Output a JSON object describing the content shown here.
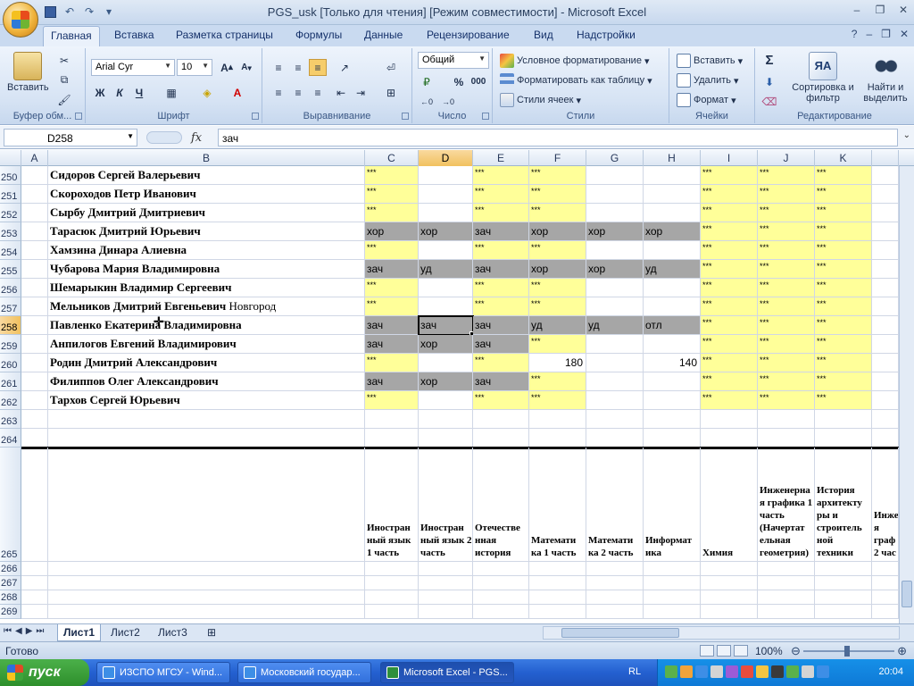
{
  "window": {
    "title": "PGS_usk  [Только для чтения]  [Режим совместимости] - Microsoft Excel"
  },
  "ribbon_tabs": [
    "Главная",
    "Вставка",
    "Разметка страницы",
    "Формулы",
    "Данные",
    "Рецензирование",
    "Вид",
    "Надстройки"
  ],
  "ribbon": {
    "clipboard": {
      "paste": "Вставить",
      "label": "Буфер обм..."
    },
    "font": {
      "name": "Arial Cyr",
      "size": "10",
      "bold": "Ж",
      "italic": "К",
      "underline": "Ч",
      "label": "Шрифт"
    },
    "alignment": {
      "label": "Выравнивание"
    },
    "number": {
      "format": "Общий",
      "percent": "%",
      "thousands": "000",
      "label": "Число"
    },
    "styles": {
      "conditional": "Условное форматирование",
      "as_table": "Форматировать как таблицу",
      "cell_styles": "Стили ячеек",
      "label": "Стили"
    },
    "cells": {
      "insert": "Вставить",
      "delete": "Удалить",
      "format": "Формат",
      "label": "Ячейки"
    },
    "editing": {
      "sigma": "Σ",
      "sort": "Сортировка и фильтр",
      "find": "Найти и выделить",
      "label": "Редактирование"
    }
  },
  "formula_bar": {
    "name_box": "D258",
    "fx": "fx",
    "value": "зач"
  },
  "columns": [
    "A",
    "B",
    "C",
    "D",
    "E",
    "F",
    "G",
    "H",
    "I",
    "J",
    "K"
  ],
  "rows": [
    {
      "num": "250",
      "name": "Сидоров Сергей Валерьевич",
      "cells": [
        "***",
        "",
        "***",
        "***",
        "",
        "",
        "***",
        "***",
        "***"
      ]
    },
    {
      "num": "251",
      "name": "Скороходов Петр Иванович",
      "cells": [
        "***",
        "",
        "***",
        "***",
        "",
        "",
        "***",
        "***",
        "***"
      ]
    },
    {
      "num": "252",
      "name": "Сырбу Дмитрий Дмитриевич",
      "cells": [
        "***",
        "",
        "***",
        "***",
        "",
        "",
        "***",
        "***",
        "***"
      ]
    },
    {
      "num": "253",
      "name": "Тарасюк Дмитрий Юрьевич",
      "cells": [
        "хор",
        "хор",
        "зач",
        "хор",
        "хор",
        "хор",
        "***",
        "***",
        "***"
      ]
    },
    {
      "num": "254",
      "name": "Хамзина Динара Алиевна",
      "cells": [
        "***",
        "",
        "***",
        "***",
        "",
        "",
        "***",
        "***",
        "***"
      ]
    },
    {
      "num": "255",
      "name": "Чубарова Мария Владимировна",
      "cells": [
        "зач",
        "уд",
        "зач",
        "хор",
        "хор",
        "уд",
        "***",
        "***",
        "***"
      ]
    },
    {
      "num": "256",
      "name": "Шемарыкин Владимир Сергеевич",
      "cells": [
        "***",
        "",
        "***",
        "***",
        "",
        "",
        "***",
        "***",
        "***"
      ]
    },
    {
      "num": "257",
      "name": "Мельников Дмитрий Евгеньевич",
      "name_extra": "Новгород",
      "cells": [
        "***",
        "",
        "***",
        "***",
        "",
        "",
        "***",
        "***",
        "***"
      ]
    },
    {
      "num": "258",
      "name": "Павленко Екатерина Владимировна",
      "cells": [
        "зач",
        "зач",
        "зач",
        "уд",
        "уд",
        "отл",
        "***",
        "***",
        "***"
      ]
    },
    {
      "num": "259",
      "name": "Анпилогов Евгений Владимирович",
      "cells": [
        "зач",
        "хор",
        "зач",
        "***",
        "",
        "",
        "***",
        "***",
        "***"
      ]
    },
    {
      "num": "260",
      "name": "Родин Дмитрий Александрович",
      "cells": [
        "***",
        "",
        "***",
        "180",
        "",
        "140",
        "***",
        "***",
        "***"
      ]
    },
    {
      "num": "261",
      "name": "Филиппов Олег Александрович",
      "cells": [
        "зач",
        "хор",
        "зач",
        "***",
        "",
        "",
        "***",
        "***",
        "***"
      ]
    },
    {
      "num": "262",
      "name": "Тархов Сергей Юрьевич",
      "cells": [
        "***",
        "",
        "***",
        "***",
        "",
        "",
        "***",
        "***",
        "***"
      ]
    }
  ],
  "empty_rows_before": [
    "263",
    "264"
  ],
  "header_row": {
    "num": "265",
    "cells": [
      "Иностран ный язык 1 часть",
      "Иностран ный язык 2 часть",
      "Отечестве нная история",
      "Математи ка 1 часть",
      "Математи ка 2 часть",
      "Информат ика",
      "Химия",
      "Инженерна я графика 1 часть (Начертат ельная геометрия)",
      "История архитекту ры и строитель ной техники",
      "Инже я граф 2 час"
    ]
  },
  "empty_rows_after": [
    "266",
    "267",
    "268",
    "269"
  ],
  "sheet_tabs": [
    "Лист1",
    "Лист2",
    "Лист3"
  ],
  "status": {
    "ready": "Готово",
    "zoom": "100%"
  },
  "taskbar": {
    "start": "пуск",
    "tasks": [
      "ИЗСПО МГСУ - Wind...",
      "Московский государ...",
      "Microsoft Excel - PGS..."
    ],
    "lang": "RL",
    "clock": "20:04"
  },
  "colors": {
    "yellow": "#ffff99",
    "gray": "#a6a6a6",
    "selected_header": "#f1c15f"
  }
}
